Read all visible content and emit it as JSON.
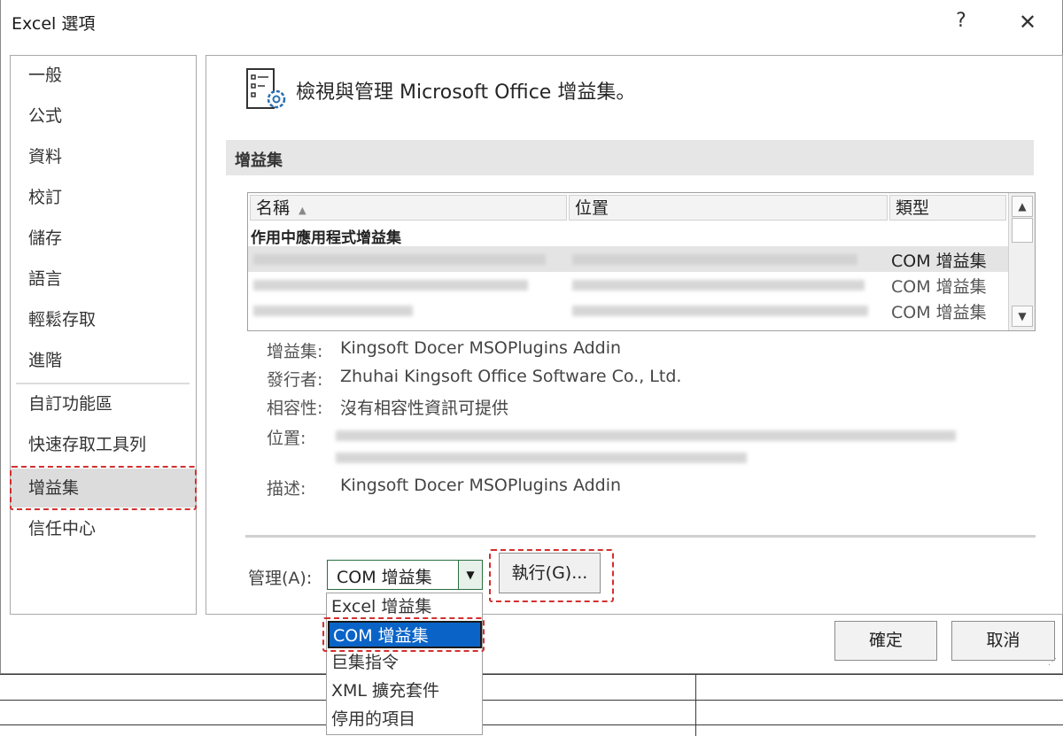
{
  "window": {
    "title": "Excel 選項",
    "help_label": "?",
    "close_label": "✕"
  },
  "sidebar": {
    "items": [
      {
        "label": "一般"
      },
      {
        "label": "公式"
      },
      {
        "label": "資料"
      },
      {
        "label": "校訂"
      },
      {
        "label": "儲存"
      },
      {
        "label": "語言"
      },
      {
        "label": "輕鬆存取"
      },
      {
        "label": "進階"
      },
      {
        "label": "自訂功能區"
      },
      {
        "label": "快速存取工具列"
      },
      {
        "label": "增益集"
      },
      {
        "label": "信任中心"
      }
    ],
    "selected": "增益集"
  },
  "content": {
    "header_icon": "addin-settings-icon",
    "header_text": "檢視與管理 Microsoft Office 增益集。",
    "section_title": "增益集",
    "table": {
      "columns": [
        "名稱",
        "位置",
        "類型"
      ],
      "sort_indicator": "▲",
      "group_label": "作用中應用程式增益集",
      "rows": [
        {
          "type": "COM 增益集",
          "selected": true
        },
        {
          "type": "COM 增益集",
          "selected": false
        },
        {
          "type": "COM 增益集",
          "selected": false
        }
      ],
      "scroll_up_label": "▲",
      "scroll_down_label": "▼"
    },
    "details": {
      "addin_label": "增益集:",
      "addin_value": "Kingsoft Docer MSOPlugins Addin",
      "publisher_label": "發行者:",
      "publisher_value": "Zhuhai Kingsoft Office Software Co., Ltd.",
      "compat_label": "相容性:",
      "compat_value": "沒有相容性資訊可提供",
      "location_label": "位置:",
      "description_label": "描述:",
      "description_value": "Kingsoft Docer MSOPlugins Addin"
    },
    "manage": {
      "label": "管理(A):",
      "selected_value": "COM 增益集",
      "arrow": "▼",
      "go_label": "執行(G)...",
      "options": [
        "Excel 增益集",
        "COM 增益集",
        "巨集指令",
        "XML 擴充套件",
        "停用的項目"
      ],
      "highlighted_option": "COM 增益集"
    }
  },
  "footer": {
    "ok_label": "確定",
    "cancel_label": "取消"
  },
  "colors": {
    "highlight_box": "#d32f2f",
    "dropdown_selected": "#0a64c8",
    "manage_border": "#2a6e3f"
  }
}
